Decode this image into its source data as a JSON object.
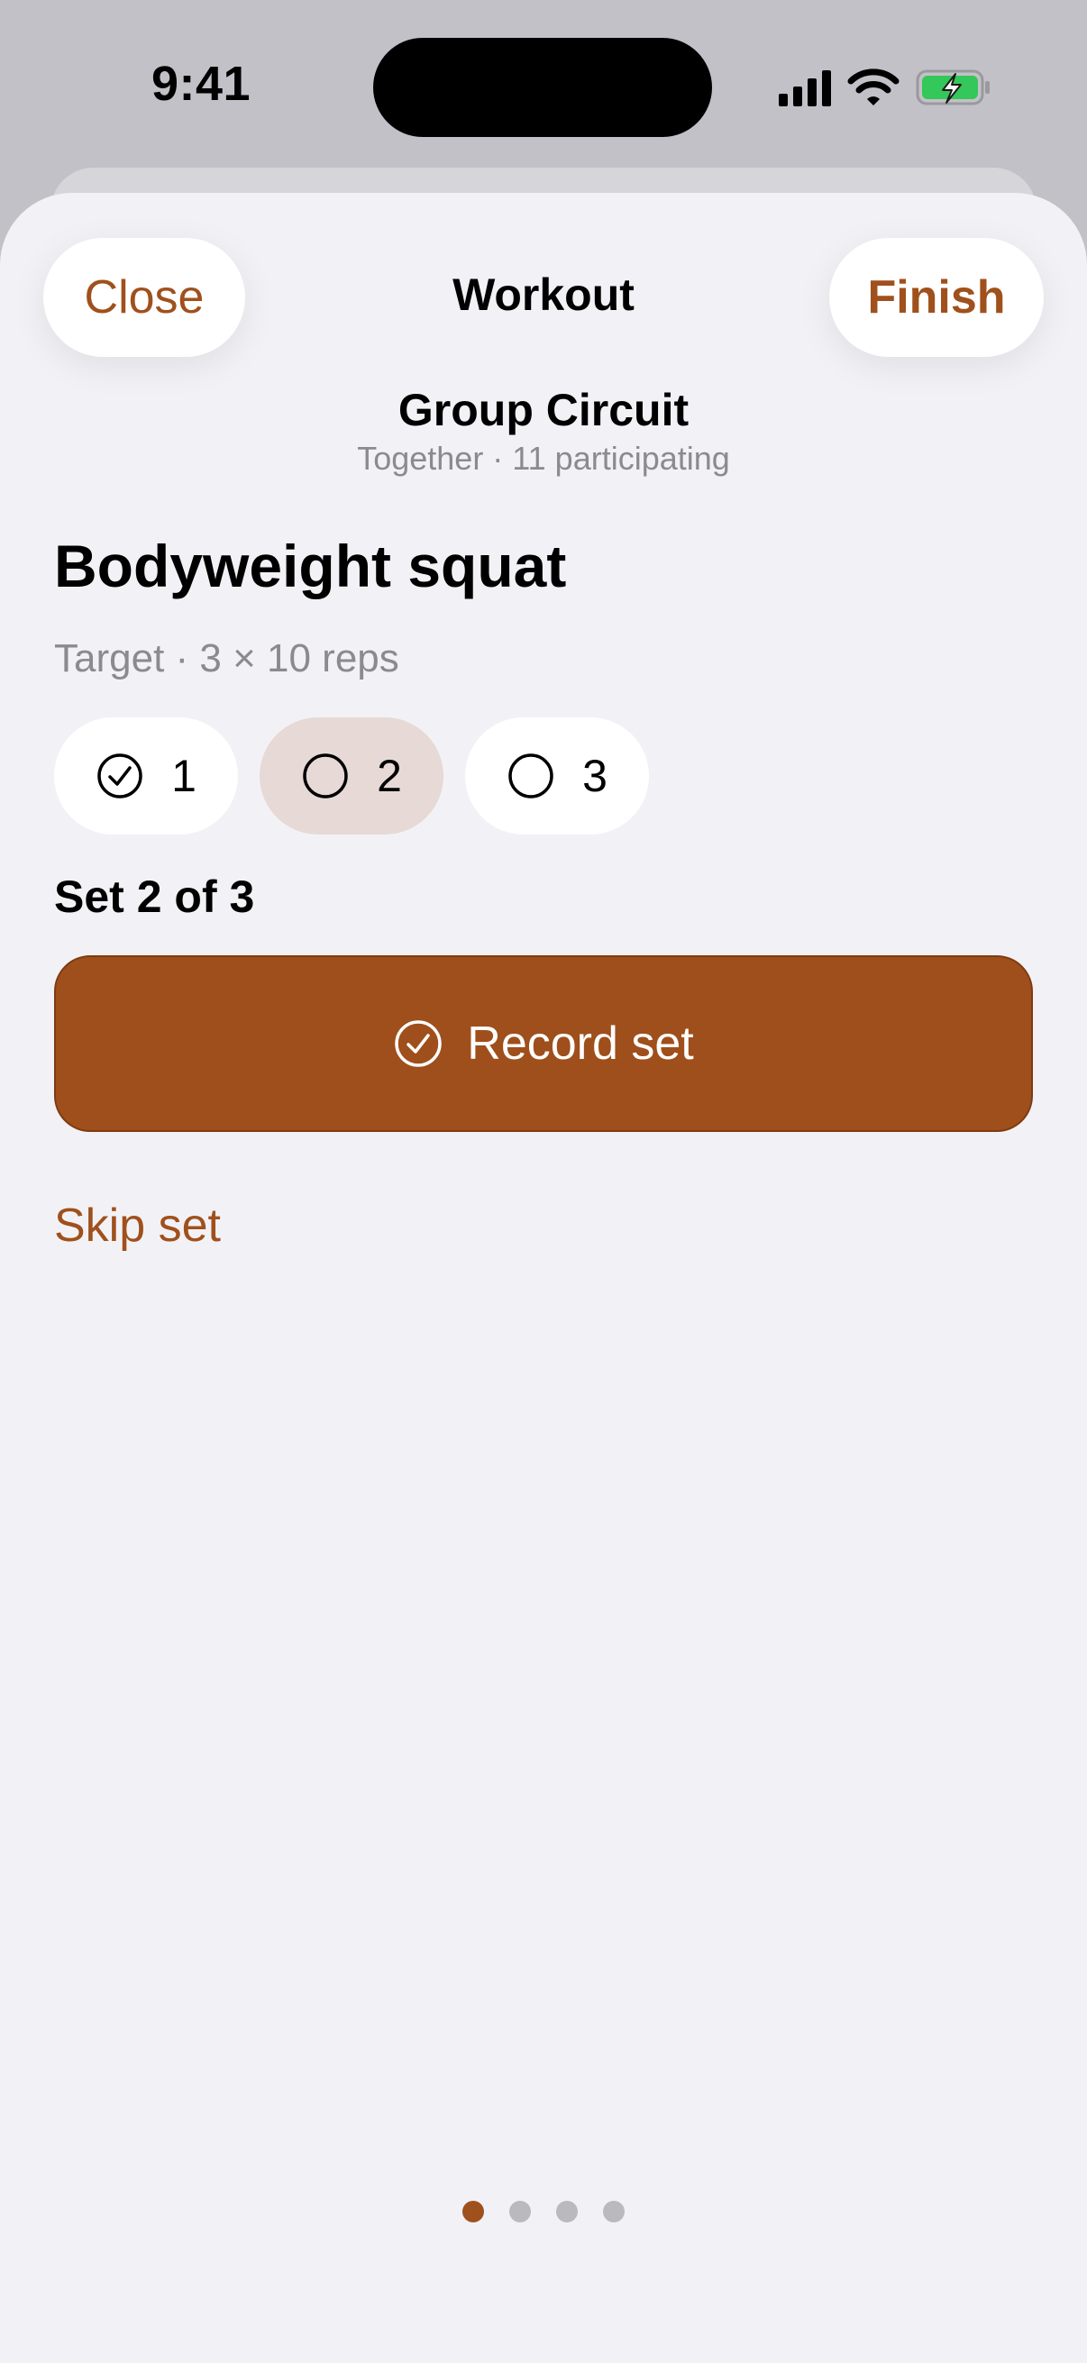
{
  "status_bar": {
    "time": "9:41"
  },
  "nav": {
    "close_label": "Close",
    "title": "Workout",
    "finish_label": "Finish"
  },
  "group": {
    "title": "Group Circuit",
    "subtitle": "Together · 11 participating"
  },
  "exercise": {
    "title": "Bodyweight squat",
    "target": "Target · 3 × 10 reps",
    "sets": [
      {
        "label": "1",
        "completed": true,
        "active": false
      },
      {
        "label": "2",
        "completed": false,
        "active": true
      },
      {
        "label": "3",
        "completed": false,
        "active": false
      }
    ],
    "progress": "Set 2 of 3",
    "record_label": "Record set",
    "skip_label": "Skip set"
  },
  "pager": {
    "total": 4,
    "current": 1
  },
  "colors": {
    "accent": "#a0501c",
    "record_bg": "#9f4f1b",
    "active_chip": "#e6d9d6",
    "sheet_bg": "#f2f2f6",
    "battery_green": "#34c759"
  },
  "icons": {
    "signal": "cellular-signal-icon",
    "wifi": "wifi-icon",
    "battery": "battery-charging-icon",
    "set_done": "checkmark-circle-icon",
    "set_pending": "empty-circle-icon",
    "record": "checkmark-circle-icon"
  }
}
